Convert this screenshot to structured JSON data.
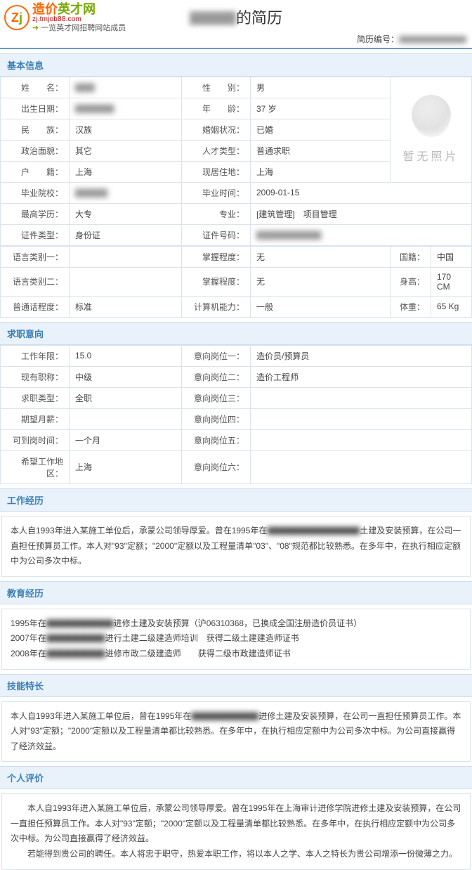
{
  "header": {
    "logo_cn_left": "造价",
    "logo_cn_right": "英才网",
    "logo_en": "zj.tmjob88.com",
    "logo_sub": "一览英才网招聘网站成员",
    "title_hidden": "▇▇▇",
    "title_suffix": "的简历",
    "id_label": "简历编号：",
    "id_value": "▇▇▇▇▇▇▇▇"
  },
  "sections": {
    "basic": "基本信息",
    "intent": "求职意向",
    "work": "工作经历",
    "edu": "教育经历",
    "skill": "技能特长",
    "self": "个人评价"
  },
  "basic": {
    "name_lbl": "姓　　名：",
    "name_val": "▇▇▇",
    "gender_lbl": "性　　别：",
    "gender_val": "男",
    "birth_lbl": "出生日期：",
    "birth_val": "▇▇▇▇▇▇",
    "age_lbl": "年　　龄：",
    "age_val": "37 岁",
    "nation_lbl": "民　　族：",
    "nation_val": "汉族",
    "marital_lbl": "婚姻状况：",
    "marital_val": "已婚",
    "polit_lbl": "政治面貌：",
    "polit_val": "其它",
    "talent_lbl": "人才类型：",
    "talent_val": "普通求职",
    "huji_lbl": "户　　籍：",
    "huji_val": "上海",
    "resid_lbl": "现居住地：",
    "resid_val": "上海",
    "school_lbl": "毕业院校：",
    "school_val": "▇▇▇▇▇",
    "gradtime_lbl": "毕业时间：",
    "gradtime_val": "2009-01-15",
    "edu_lbl": "最高学历：",
    "edu_val": "大专",
    "major_lbl": "专业：",
    "major_val": "[建筑管理]　项目管理",
    "idtype_lbl": "证件类型：",
    "idtype_val": "身份证",
    "idno_lbl": "证件号码：",
    "idno_val": "▇▇▇▇▇▇▇▇▇▇",
    "lang1_lbl": "语言类别一：",
    "lang1_val": "",
    "lang1lv_lbl": "掌握程度：",
    "lang1lv_val": "无",
    "nationality_lbl": "国籍：",
    "nationality_val": "中国",
    "lang2_lbl": "语言类别二：",
    "lang2_val": "",
    "lang2lv_lbl": "掌握程度：",
    "lang2lv_val": "无",
    "height_lbl": "身高：",
    "height_val": "170 CM",
    "pth_lbl": "普通话程度：",
    "pth_val": "标准",
    "comp_lbl": "计算机能力：",
    "comp_val": "一般",
    "weight_lbl": "体重：",
    "weight_val": "65 Kg",
    "photo_text": "暂无照片"
  },
  "intent": {
    "years_lbl": "工作年限：",
    "years_val": "15.0",
    "pos1_lbl": "意向岗位一：",
    "pos1_val": "造价员/预算员",
    "title_lbl": "现有职称：",
    "title_val": "中级",
    "pos2_lbl": "意向岗位二：",
    "pos2_val": "造价工程师",
    "type_lbl": "求职类型：",
    "type_val": "全职",
    "pos3_lbl": "意向岗位三：",
    "pos3_val": "",
    "salary_lbl": "期望月薪：",
    "salary_val": "",
    "pos4_lbl": "意向岗位四：",
    "pos4_val": "",
    "avail_lbl": "可到岗时间：",
    "avail_val": "一个月",
    "pos5_lbl": "意向岗位五：",
    "pos5_val": "",
    "area_lbl": "希望工作地区：",
    "area_val": "上海",
    "pos6_lbl": "意向岗位六：",
    "pos6_val": ""
  },
  "work_text": {
    "p1a": "本人自1993年进入某施工单位后，承蒙公司领导厚爱。曾在1995年在",
    "p1b": "▇▇▇▇▇▇▇▇▇▇▇",
    "p1c": "土建及安装预算，在公司一直担任预算员工作。本人对\"93\"定额；\"2000\"定额以及工程量清单\"03\"、\"08\"规范都比较熟悉。在多年中，在执行相应定额中为公司多次中标。"
  },
  "edu_text": {
    "l1a": "1995年在",
    "l1b": "▇▇▇▇▇▇▇▇",
    "l1c": "进修土建及安装预算（沪06310368，已换成全国注册造价员证书）",
    "l2a": "2007年在",
    "l2b": "▇▇▇▇▇▇▇",
    "l2c": "进行土建二级建造师培训　获得二级土建建造师证书",
    "l3a": "2008年在",
    "l3b": "▇▇▇▇▇▇▇",
    "l3c": "进修市政二级建造师　　获得二级市政建造师证书"
  },
  "skill_text": {
    "p1a": "本人自1993年进入某施工单位后，曾在1995年在",
    "p1b": "▇▇▇▇▇▇▇▇",
    "p1c": "进修土建及安装预算，在公司一直担任预算员工作。本人对\"93\"定额；\"2000\"定额以及工程量清单都比较熟悉。在多年中，在执行相应定额中为公司多次中标。为公司直接赢得了经济效益。"
  },
  "self_text": {
    "p1": "　　本人自1993年进入某施工单位后，承蒙公司领导厚爱。曾在1995年在上海审计进修学院进修土建及安装预算，在公司一直担任预算员工作。本人对\"93\"定额；\"2000\"定额以及工程量清单都比较熟悉。在多年中，在执行相应定额中为公司多次中标。为公司直接赢得了经济效益。",
    "p2": "　　若能得到贵公司的聘任。本人将忠于职守，热爱本职工作，将以本人之学、本人之特长为贵公司增添一份微薄之力。"
  }
}
